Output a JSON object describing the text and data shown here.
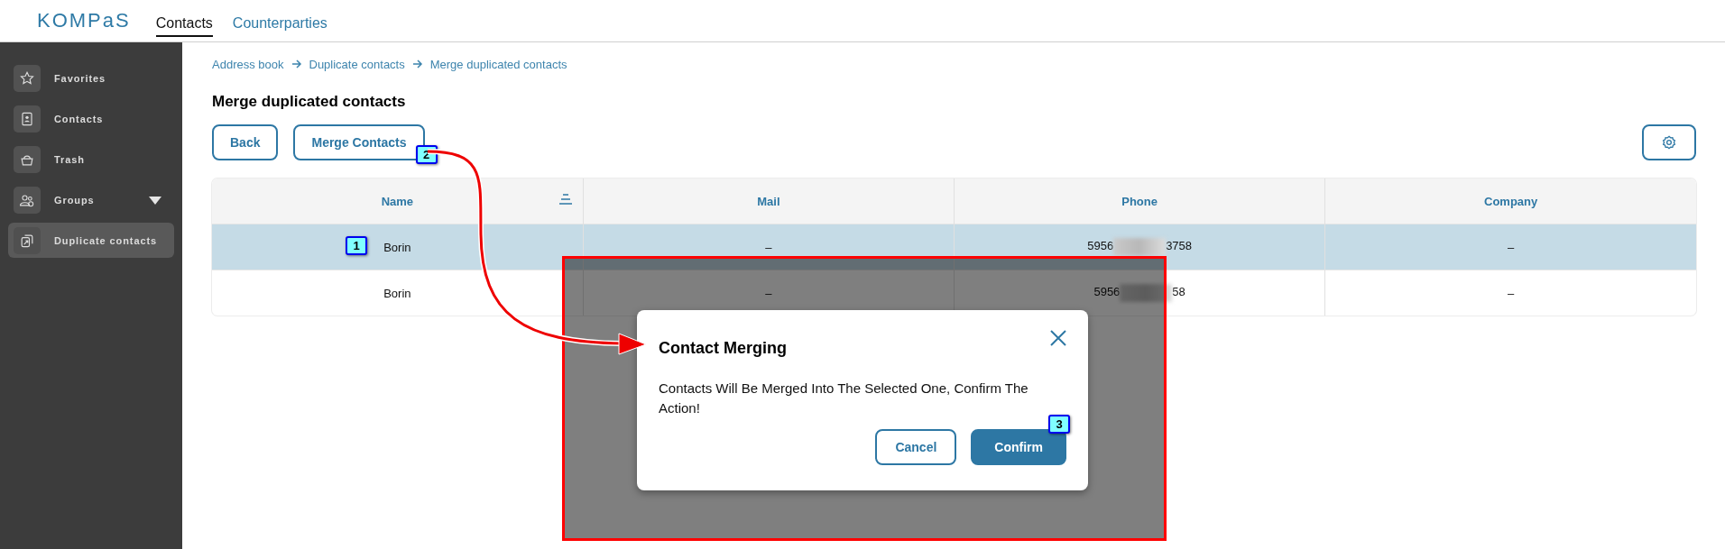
{
  "header": {
    "logo": "KOMPaS",
    "nav": [
      {
        "label": "Contacts",
        "selected": true
      },
      {
        "label": "Counterparties",
        "selected": false
      }
    ]
  },
  "sidebar": {
    "items": [
      {
        "label": "Favorites",
        "kind": "star",
        "selected": false,
        "expandable": false
      },
      {
        "label": "Contacts",
        "kind": "badge",
        "selected": false,
        "expandable": false
      },
      {
        "label": "Trash",
        "kind": "basket",
        "selected": false,
        "expandable": false
      },
      {
        "label": "Groups",
        "kind": "people",
        "selected": false,
        "expandable": true
      },
      {
        "label": "Duplicate contacts",
        "kind": "copy",
        "selected": true,
        "expandable": false
      }
    ]
  },
  "breadcrumbs": [
    "Address book",
    "Duplicate contacts",
    "Merge duplicated contacts"
  ],
  "title": "Merge duplicated contacts",
  "toolbar": {
    "buttons": [
      {
        "label": "Back"
      },
      {
        "label": "Merge Contacts",
        "callout": "2"
      }
    ]
  },
  "table": {
    "columns": [
      {
        "label": "Name",
        "sortable": true
      },
      {
        "label": "Mail",
        "sortable": false
      },
      {
        "label": "Phone",
        "sortable": false
      },
      {
        "label": "Company",
        "sortable": false
      }
    ],
    "rows": [
      {
        "selected": true,
        "callout": "1",
        "name": "Borin",
        "mail": "–",
        "phone_start": "5956",
        "phone_end": "3758",
        "company": "–"
      },
      {
        "selected": false,
        "name": "Borin",
        "mail": "–",
        "phone_start": "5956",
        "phone_end": "58",
        "company": "–"
      }
    ]
  },
  "dialog": {
    "highlighted": true,
    "title": "Contact Merging",
    "message": "Contacts Will Be Merged Into The Selected One, Confirm The Action!",
    "buttons": [
      {
        "label": "Cancel",
        "kind": "secondary"
      },
      {
        "label": "Confirm",
        "kind": "primary",
        "callout": "3"
      }
    ]
  }
}
